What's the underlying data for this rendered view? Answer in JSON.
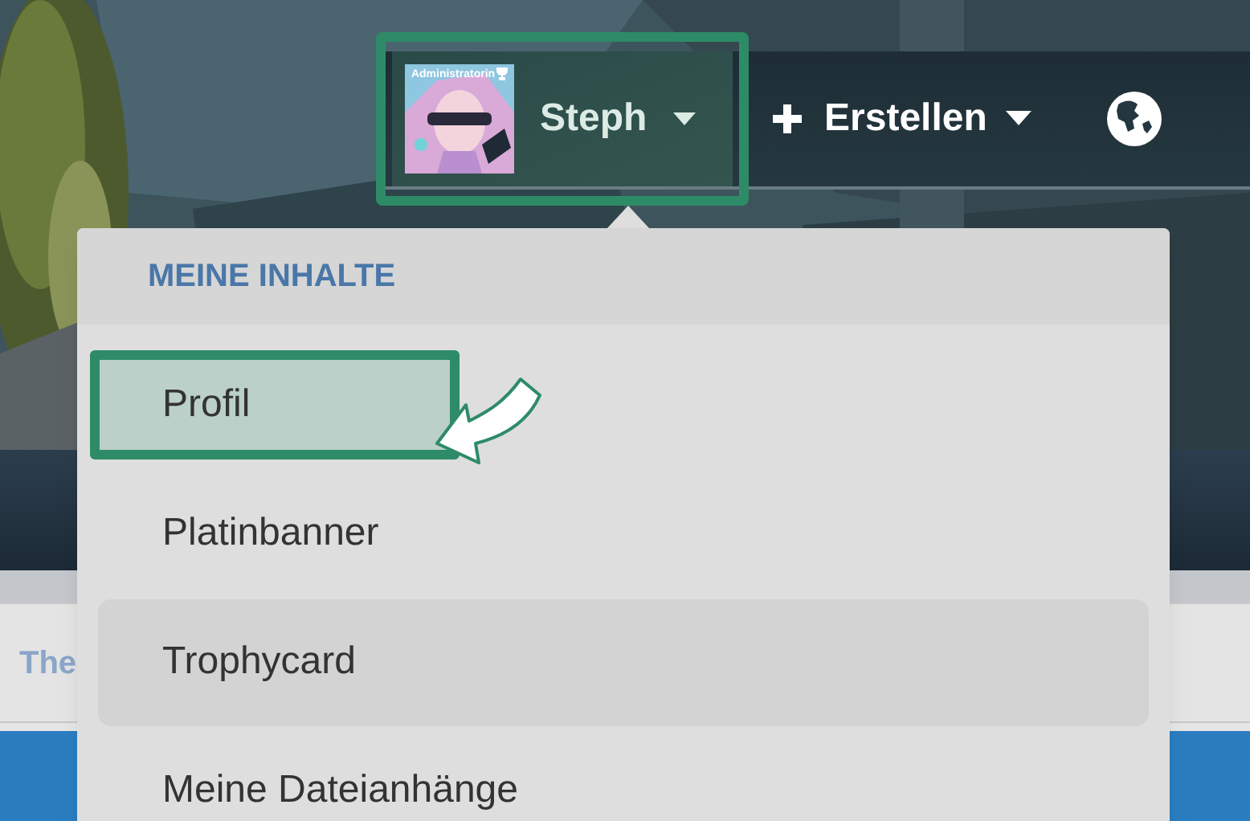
{
  "nav": {
    "user": {
      "avatar_badge": "Administratorin",
      "name": "Steph",
      "annotated": true
    },
    "create_label": "Erstellen"
  },
  "dropdown": {
    "header": "MEINE INHALTE",
    "items": [
      {
        "label": "Profil",
        "annotated": true,
        "hovered": false
      },
      {
        "label": "Platinbanner",
        "annotated": false,
        "hovered": false
      },
      {
        "label": "Trophycard",
        "annotated": false,
        "hovered": true
      },
      {
        "label": "Meine Dateianhänge",
        "annotated": false,
        "hovered": false
      }
    ]
  },
  "page": {
    "panel_text": "The"
  }
}
